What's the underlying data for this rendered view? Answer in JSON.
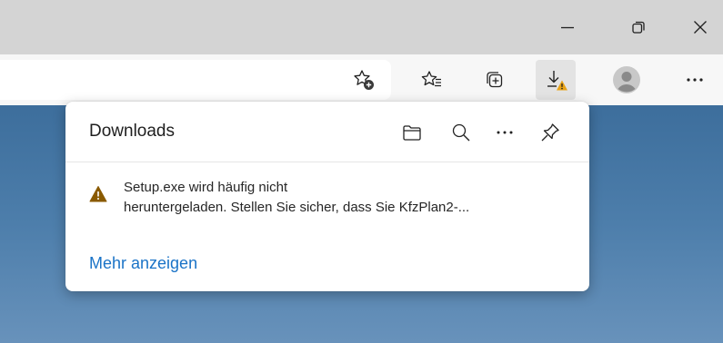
{
  "window_controls": {
    "minimize_icon": "minimize-icon",
    "restore_icon": "restore-icon",
    "close_icon": "close-icon"
  },
  "toolbar": {
    "icons": [
      "add-favorite-icon",
      "favorites-icon",
      "collections-icon",
      "downloads-icon",
      "profile-avatar",
      "more-icon"
    ],
    "warning_color": "#e8a317"
  },
  "downloads": {
    "title": "Downloads",
    "actions": [
      "open-folder-icon",
      "search-icon",
      "more-options-icon",
      "pin-icon"
    ],
    "item": {
      "line1": "Setup.exe wird häufig nicht",
      "line2": "heruntergeladen. Stellen Sie sicher, dass Sie KfzPlan2-...",
      "icon": "warning-icon",
      "warning_color": "#8a5a00"
    },
    "more_link": "Mehr anzeigen",
    "link_color": "#1a73c7"
  }
}
